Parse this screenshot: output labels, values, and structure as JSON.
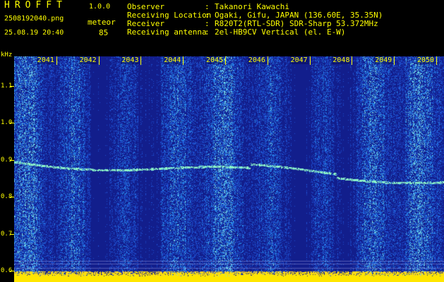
{
  "header": {
    "title": "HROFFT",
    "version": "1.0.0",
    "filename": "2508192040.png",
    "datetime": "25.08.19 20:40",
    "detection_type": "meteor",
    "detection_count": "85"
  },
  "metadata": [
    {
      "label": "Observer",
      "value": "Takanori Kawachi"
    },
    {
      "label": "Receiving Location",
      "value": "Ogaki, Gifu, JAPAN (136.60E, 35.35N)"
    },
    {
      "label": "Receiver",
      "value": "R820T2(RTL-SDR) SDR-Sharp 53.372MHz"
    },
    {
      "label": "Receiving antenna",
      "value": "2el-HB9CV Vertical (el. E-W)"
    }
  ],
  "spectrogram": {
    "freq_unit": "kHz",
    "freq_ticks": [
      {
        "value": 1.1,
        "label": "1.1"
      },
      {
        "value": 1.0,
        "label": "1.0"
      },
      {
        "value": 0.9,
        "label": "0.9"
      },
      {
        "value": 0.8,
        "label": "0.8"
      },
      {
        "value": 0.7,
        "label": "0.7"
      },
      {
        "value": 0.6,
        "label": "0.6"
      }
    ],
    "time_ticks": [
      {
        "minute": 2041,
        "label": "2041"
      },
      {
        "minute": 2042,
        "label": "2042"
      },
      {
        "minute": 2043,
        "label": "2043"
      },
      {
        "minute": 2044,
        "label": "2044"
      },
      {
        "minute": 2045,
        "label": "2045"
      },
      {
        "minute": 2046,
        "label": "2046"
      },
      {
        "minute": 2047,
        "label": "2047"
      },
      {
        "minute": 2048,
        "label": "2048"
      },
      {
        "minute": 2049,
        "label": "2049"
      },
      {
        "minute": 2050,
        "label": "2050"
      }
    ],
    "freq_range_khz": [
      0.57,
      1.18
    ],
    "time_range_min": [
      2040.0,
      2050.0
    ],
    "colors": {
      "background": "#141a8a",
      "noise": "#2a56d8",
      "signal": "#7ff0c0",
      "text": "#ffff00"
    }
  }
}
